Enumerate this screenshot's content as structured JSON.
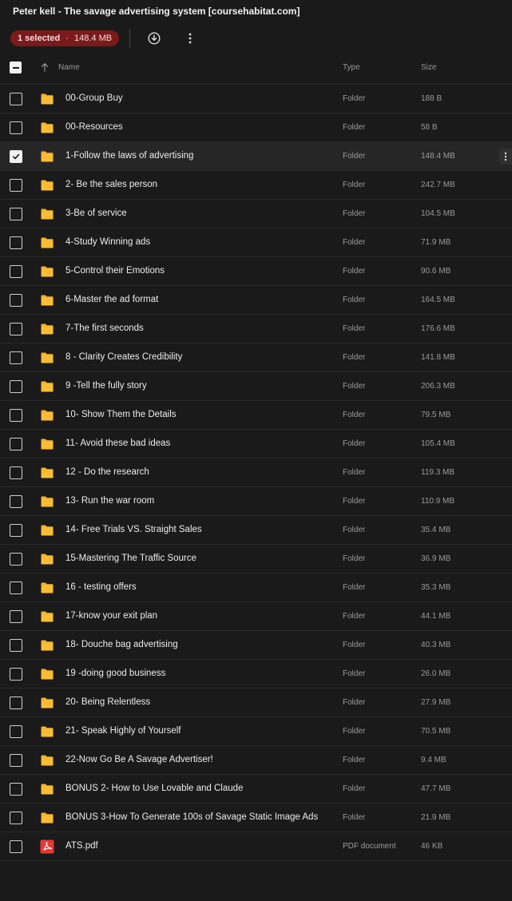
{
  "title": "Peter kell - The savage advertising system [coursehabitat.com]",
  "toolbar": {
    "selected_count": "1 selected",
    "separator": "·",
    "selected_size": "148.4 MB",
    "download_icon": "download-icon",
    "more_icon": "more-vertical-icon"
  },
  "header": {
    "name": "Name",
    "type": "Type",
    "size": "Size",
    "sort_icon": "arrow-up-icon"
  },
  "colors": {
    "background": "#1a1a1a",
    "folder": "#f7b32b",
    "selected_badge": "#7a1a1a",
    "pdf": "#e53935"
  },
  "files": [
    {
      "name": "00-Group Buy",
      "type": "Folder",
      "size": "188 B",
      "icon": "folder-icon",
      "selected": false
    },
    {
      "name": "00-Resources",
      "type": "Folder",
      "size": "58 B",
      "icon": "folder-icon",
      "selected": false
    },
    {
      "name": "1-Follow the laws of advertising",
      "type": "Folder",
      "size": "148.4 MB",
      "icon": "folder-icon",
      "selected": true
    },
    {
      "name": "2- Be the sales person",
      "type": "Folder",
      "size": "242.7 MB",
      "icon": "folder-icon",
      "selected": false
    },
    {
      "name": "3-Be of service",
      "type": "Folder",
      "size": "104.5 MB",
      "icon": "folder-icon",
      "selected": false
    },
    {
      "name": "4-Study Winning ads",
      "type": "Folder",
      "size": "71.9 MB",
      "icon": "folder-icon",
      "selected": false
    },
    {
      "name": "5-Control their Emotions",
      "type": "Folder",
      "size": "90.6 MB",
      "icon": "folder-icon",
      "selected": false
    },
    {
      "name": "6-Master the ad format",
      "type": "Folder",
      "size": "164.5 MB",
      "icon": "folder-icon",
      "selected": false
    },
    {
      "name": "7-The first seconds",
      "type": "Folder",
      "size": "176.6 MB",
      "icon": "folder-icon",
      "selected": false
    },
    {
      "name": "8 - Clarity Creates Credibility",
      "type": "Folder",
      "size": "141.8 MB",
      "icon": "folder-icon",
      "selected": false
    },
    {
      "name": "9 -Tell the fully story",
      "type": "Folder",
      "size": "206.3 MB",
      "icon": "folder-icon",
      "selected": false
    },
    {
      "name": "10- Show Them the Details",
      "type": "Folder",
      "size": "79.5 MB",
      "icon": "folder-icon",
      "selected": false
    },
    {
      "name": "11- Avoid these bad ideas",
      "type": "Folder",
      "size": "105.4 MB",
      "icon": "folder-icon",
      "selected": false
    },
    {
      "name": "12 - Do the research",
      "type": "Folder",
      "size": "119.3 MB",
      "icon": "folder-icon",
      "selected": false
    },
    {
      "name": "13- Run the war room",
      "type": "Folder",
      "size": "110.9 MB",
      "icon": "folder-icon",
      "selected": false
    },
    {
      "name": "14- Free Trials VS. Straight Sales",
      "type": "Folder",
      "size": "35.4 MB",
      "icon": "folder-icon",
      "selected": false
    },
    {
      "name": "15-Mastering The Traffic Source",
      "type": "Folder",
      "size": "36.9 MB",
      "icon": "folder-icon",
      "selected": false
    },
    {
      "name": "16 - testing offers",
      "type": "Folder",
      "size": "35.3 MB",
      "icon": "folder-icon",
      "selected": false
    },
    {
      "name": "17-know your exit plan",
      "type": "Folder",
      "size": "44.1 MB",
      "icon": "folder-icon",
      "selected": false
    },
    {
      "name": "18- Douche bag advertising",
      "type": "Folder",
      "size": "40.3 MB",
      "icon": "folder-icon",
      "selected": false
    },
    {
      "name": "19 -doing good business",
      "type": "Folder",
      "size": "26.0 MB",
      "icon": "folder-icon",
      "selected": false
    },
    {
      "name": "20- Being Relentless",
      "type": "Folder",
      "size": "27.9 MB",
      "icon": "folder-icon",
      "selected": false
    },
    {
      "name": "21- Speak Highly of Yourself",
      "type": "Folder",
      "size": "70.5 MB",
      "icon": "folder-icon",
      "selected": false
    },
    {
      "name": "22-Now Go Be A Savage Advertiser!",
      "type": "Folder",
      "size": "9.4 MB",
      "icon": "folder-icon",
      "selected": false
    },
    {
      "name": "BONUS 2- How to Use Lovable and Claude",
      "type": "Folder",
      "size": "47.7 MB",
      "icon": "folder-icon",
      "selected": false
    },
    {
      "name": "BONUS 3-How To Generate 100s of Savage Static Image Ads",
      "type": "Folder",
      "size": "21.9 MB",
      "icon": "folder-icon",
      "selected": false
    },
    {
      "name": "ATS.pdf",
      "type": "PDF document",
      "size": "46 KB",
      "icon": "pdf-icon",
      "selected": false
    }
  ]
}
